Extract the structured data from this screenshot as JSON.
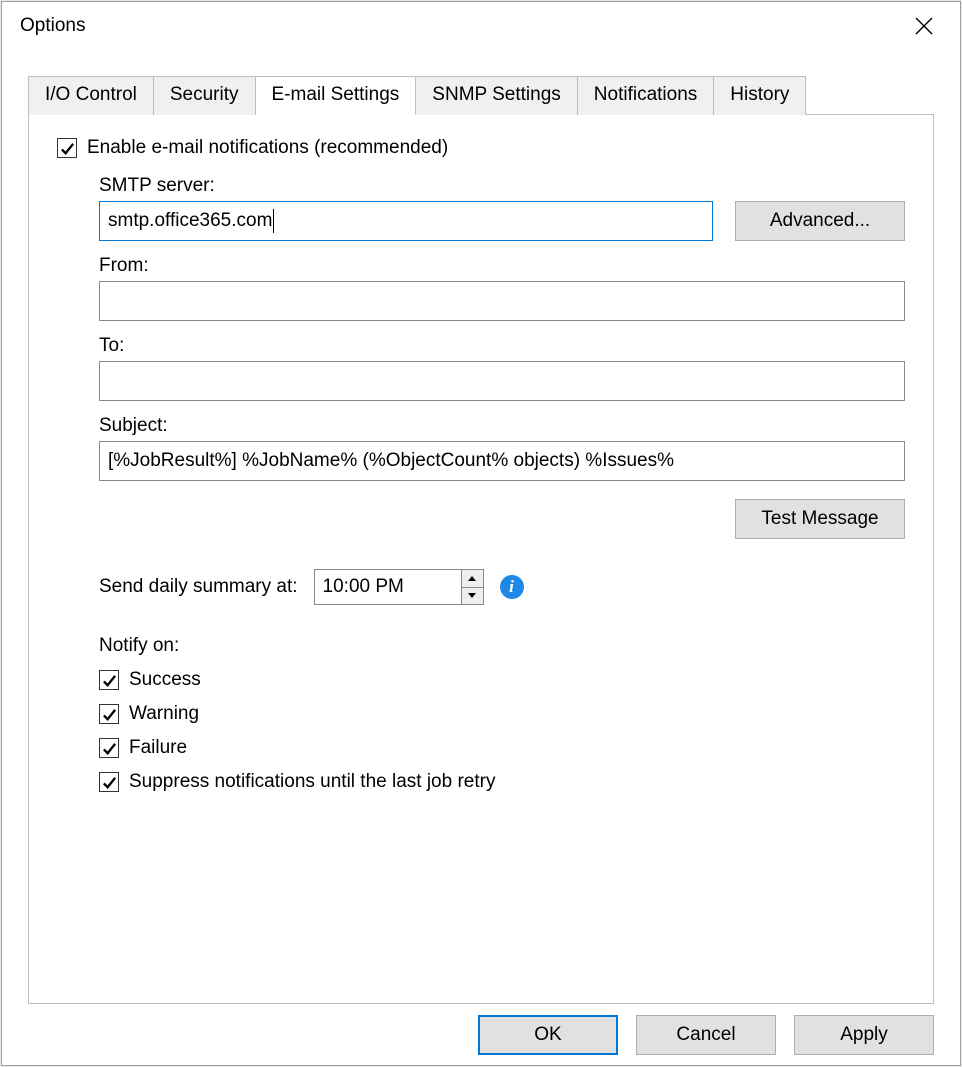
{
  "window": {
    "title": "Options"
  },
  "tabs": [
    {
      "label": "I/O Control"
    },
    {
      "label": "Security"
    },
    {
      "label": "E-mail Settings",
      "active": true
    },
    {
      "label": "SNMP Settings"
    },
    {
      "label": "Notifications"
    },
    {
      "label": "History"
    }
  ],
  "email": {
    "enable_label": "Enable e-mail notifications (recommended)",
    "enable_checked": true,
    "smtp_label": "SMTP server:",
    "smtp_value": "smtp.office365.com",
    "advanced_btn": "Advanced...",
    "from_label": "From:",
    "from_value": "",
    "to_label": "To:",
    "to_value": "",
    "subject_label": "Subject:",
    "subject_value": "[%JobResult%] %JobName% (%ObjectCount% objects) %Issues%",
    "test_btn": "Test Message",
    "summary_label": "Send daily summary at:",
    "summary_time": "10:00 PM",
    "notify_label": "Notify on:",
    "notify": {
      "success": {
        "label": "Success",
        "checked": true
      },
      "warning": {
        "label": "Warning",
        "checked": true
      },
      "failure": {
        "label": "Failure",
        "checked": true
      },
      "suppress": {
        "label": "Suppress notifications until the last job retry",
        "checked": true
      }
    }
  },
  "buttons": {
    "ok": "OK",
    "cancel": "Cancel",
    "apply": "Apply"
  }
}
